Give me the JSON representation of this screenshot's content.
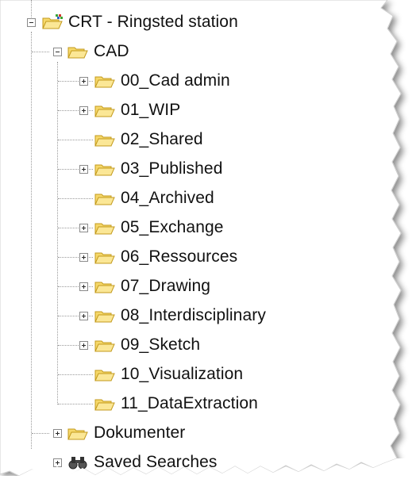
{
  "tree": {
    "root": {
      "label": "CRT - Ringsted station",
      "icon": "project-folder-icon",
      "expanded": true
    },
    "cad": {
      "label": "CAD",
      "icon": "open-folder-icon",
      "expanded": true
    },
    "cad_children": [
      {
        "label": "00_Cad admin",
        "has_children": true
      },
      {
        "label": "01_WIP",
        "has_children": true
      },
      {
        "label": "02_Shared",
        "has_children": false
      },
      {
        "label": "03_Published",
        "has_children": true
      },
      {
        "label": "04_Archived",
        "has_children": false
      },
      {
        "label": "05_Exchange",
        "has_children": true
      },
      {
        "label": "06_Ressources",
        "has_children": true
      },
      {
        "label": "07_Drawing",
        "has_children": true
      },
      {
        "label": "08_Interdisciplinary",
        "has_children": true
      },
      {
        "label": "09_Sketch",
        "has_children": true
      },
      {
        "label": "10_Visualization",
        "has_children": false
      },
      {
        "label": "11_DataExtraction",
        "has_children": false
      }
    ],
    "dokumenter": {
      "label": "Dokumenter",
      "icon": "folder-icon",
      "has_children": true
    },
    "saved_searches": {
      "label": "Saved Searches",
      "icon": "binoculars-icon",
      "has_children": true
    }
  },
  "colors": {
    "folder_fill": "#f6d86a",
    "folder_stroke": "#c39a1c",
    "project_accent_green": "#3aa336",
    "project_accent_red": "#d8342a",
    "project_accent_blue": "#2a63c8"
  }
}
